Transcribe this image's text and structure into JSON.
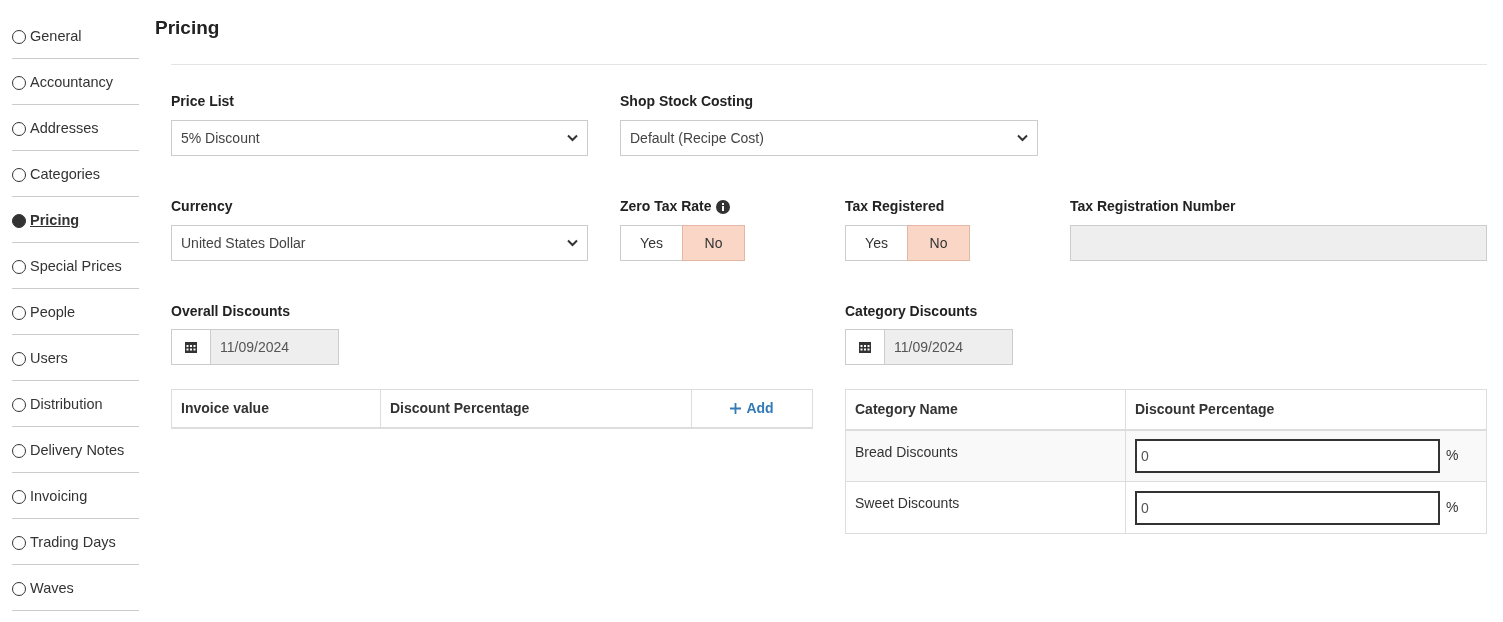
{
  "sidebar": {
    "items": [
      {
        "label": "General",
        "selected": false
      },
      {
        "label": "Accountancy",
        "selected": false
      },
      {
        "label": "Addresses",
        "selected": false
      },
      {
        "label": "Categories",
        "selected": false
      },
      {
        "label": "Pricing",
        "selected": true
      },
      {
        "label": "Special Prices",
        "selected": false
      },
      {
        "label": "People",
        "selected": false
      },
      {
        "label": "Users",
        "selected": false
      },
      {
        "label": "Distribution",
        "selected": false
      },
      {
        "label": "Delivery Notes",
        "selected": false
      },
      {
        "label": "Invoicing",
        "selected": false
      },
      {
        "label": "Trading Days",
        "selected": false
      },
      {
        "label": "Waves",
        "selected": false
      }
    ]
  },
  "title": "Pricing",
  "price_list": {
    "label": "Price List",
    "value": "5% Discount"
  },
  "shop_stock_costing": {
    "label": "Shop Stock Costing",
    "value": "Default (Recipe Cost)"
  },
  "currency": {
    "label": "Currency",
    "value": "United States Dollar"
  },
  "zero_tax_rate": {
    "label": "Zero Tax Rate",
    "options": [
      {
        "label": "Yes",
        "selected": false
      },
      {
        "label": "No",
        "selected": true
      }
    ]
  },
  "tax_registered": {
    "label": "Tax Registered",
    "options": [
      {
        "label": "Yes",
        "selected": false
      },
      {
        "label": "No",
        "selected": true
      }
    ]
  },
  "tax_registration_number": {
    "label": "Tax Registration Number",
    "disabled": true
  },
  "overall_discounts": {
    "label": "Overall Discounts",
    "date": "11/09/2024",
    "columns": [
      "Invoice value",
      "Discount Percentage"
    ],
    "add_button": "Add"
  },
  "category_discounts": {
    "label": "Category Discounts",
    "date": "11/09/2024",
    "columns": [
      "Category Name",
      "Discount Percentage"
    ],
    "rows": [
      {
        "name": "Bread Discounts",
        "value": "0",
        "unit": "%"
      },
      {
        "name": "Sweet Discounts",
        "value": "0",
        "unit": "%"
      }
    ]
  }
}
